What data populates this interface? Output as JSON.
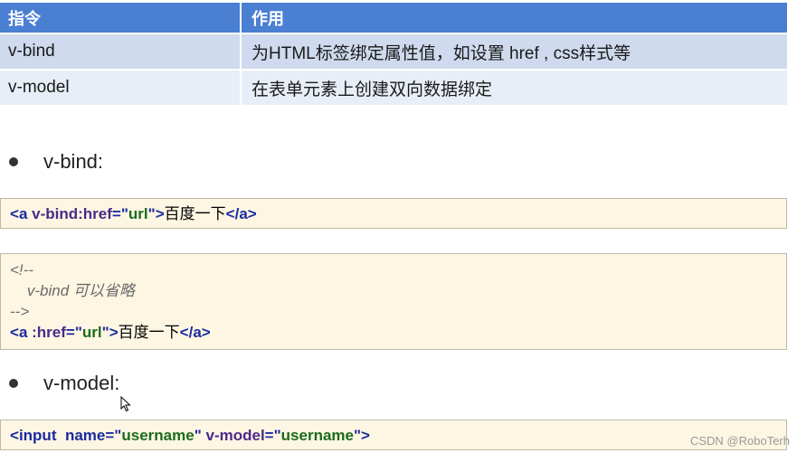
{
  "table": {
    "headers": [
      "指令",
      "作用"
    ],
    "rows": [
      {
        "directive": "v-bind",
        "purpose": "为HTML标签绑定属性值，如设置 href , css样式等"
      },
      {
        "directive": "v-model",
        "purpose": "在表单元素上创建双向数据绑定"
      }
    ]
  },
  "sections": {
    "bind_title": "v-bind:",
    "model_title": "v-model:"
  },
  "code1": {
    "lt": "<",
    "a": "a",
    "attr": "v-bind:href",
    "eq": "=\"",
    "val": "url",
    "q_gt": "\">",
    "text": "百度一下",
    "close_lt": "</",
    "close_a": "a",
    "gt": ">"
  },
  "code2": {
    "comment_open": "<!--",
    "comment_body": "    v-bind 可以省略",
    "comment_close": "-->",
    "lt": "<",
    "a": "a",
    "attr": ":href",
    "eq": "=\"",
    "val": "url",
    "q_gt": "\">",
    "text": "百度一下",
    "close_lt": "</",
    "close_a": "a",
    "gt": ">"
  },
  "code3": {
    "lt": "<",
    "tag": "input",
    "attr1": "name",
    "eq1": "=\"",
    "val1": "username",
    "q1": "\"",
    "attr2": "v-model",
    "eq2": "=\"",
    "val2": "username",
    "q2": "\">"
  },
  "watermark": "CSDN @RoboTerh",
  "icons": {
    "bullet": "bullet-dot-icon",
    "cursor": "mouse-pointer-icon"
  }
}
